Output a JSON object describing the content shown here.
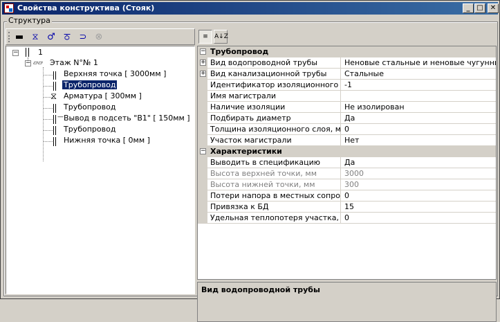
{
  "window": {
    "title": "Свойства конструктива (Стояк)",
    "buttons": {
      "minimize": "_",
      "maximize": "□",
      "close": "✕"
    }
  },
  "group_label": "Структура",
  "toolbar": {
    "icons": [
      "floor-icon",
      "valve-icon",
      "branch-icon",
      "fitting-icon",
      "return-icon",
      "delete-icon"
    ],
    "glyphs": [
      "▬",
      "⧖",
      "♂",
      "ਠ",
      "⊃",
      "⊗"
    ]
  },
  "tree": {
    "root": "1",
    "floor": "Этаж N°№ 1",
    "items": [
      "Верхняя точка [ 3000мм ]",
      "Трубопровод",
      "Арматура [ 300мм ]",
      "Трубопровод",
      "Вывод в подсеть \"В1\" [ 150мм ]",
      "Трубопровод",
      "Нижняя точка [ 0мм ]"
    ]
  },
  "property_grid": {
    "sort_buttons": [
      "categorized-icon",
      "alphabetical-icon"
    ],
    "sort_labels": [
      "≡",
      "A↓Z"
    ],
    "categories": [
      {
        "name": "Трубопровод",
        "rows": [
          {
            "name": "Вид водопроводной трубы",
            "value": "Неновые стальные и неновые чугунные без",
            "expandable": true,
            "readonly": false
          },
          {
            "name": "Вид канализационной трубы",
            "value": "Стальные",
            "expandable": true,
            "readonly": false
          },
          {
            "name": "Идентификатор изоляционного мате",
            "value": "-1",
            "expandable": false,
            "readonly": false
          },
          {
            "name": "Имя магистрали",
            "value": "",
            "expandable": false,
            "readonly": false
          },
          {
            "name": "Наличие изоляции",
            "value": "Не изолирован",
            "expandable": false,
            "readonly": false
          },
          {
            "name": "Подбирать диаметр",
            "value": "Да",
            "expandable": false,
            "readonly": false
          },
          {
            "name": "Толщина изоляционного слоя, мм",
            "value": "0",
            "expandable": false,
            "readonly": false
          },
          {
            "name": "Участок магистрали",
            "value": "Нет",
            "expandable": false,
            "readonly": false
          }
        ]
      },
      {
        "name": "Характеристики",
        "rows": [
          {
            "name": "Выводить в спецификацию",
            "value": "Да",
            "expandable": false,
            "readonly": false
          },
          {
            "name": "Высота верхней точки, мм",
            "value": "3000",
            "expandable": false,
            "readonly": true
          },
          {
            "name": "Высота нижней точки, мм",
            "value": "300",
            "expandable": false,
            "readonly": true
          },
          {
            "name": "Потери напора в местных сопротивл",
            "value": "0",
            "expandable": false,
            "readonly": false
          },
          {
            "name": "Привязка к БД",
            "value": "15",
            "expandable": false,
            "readonly": false
          },
          {
            "name": "Удельная теплопотеря участка, Вт/м",
            "value": "0",
            "expandable": false,
            "readonly": false
          }
        ]
      }
    ]
  },
  "help": {
    "title": "Вид водопроводной трубы"
  }
}
